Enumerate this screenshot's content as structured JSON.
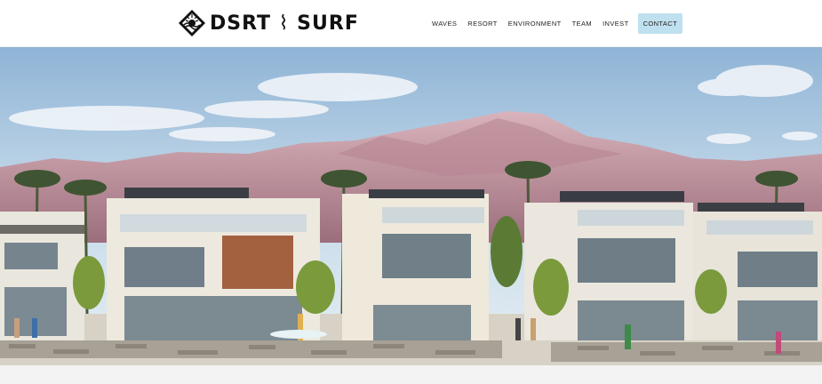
{
  "brand": {
    "name": "DSRT",
    "separator": "⌇",
    "name2": "SURF"
  },
  "nav": {
    "items": [
      {
        "label": "WAVES"
      },
      {
        "label": "RESORT"
      },
      {
        "label": "ENVIRONMENT"
      },
      {
        "label": "TEAM"
      },
      {
        "label": "INVEST"
      },
      {
        "label": "CONTACT"
      }
    ]
  },
  "colors": {
    "contact_bg": "#bfe0ee",
    "sky": "#c9dcea",
    "mountain": "#c99aa6"
  },
  "hero": {
    "image": "resort-residences-rendering"
  }
}
